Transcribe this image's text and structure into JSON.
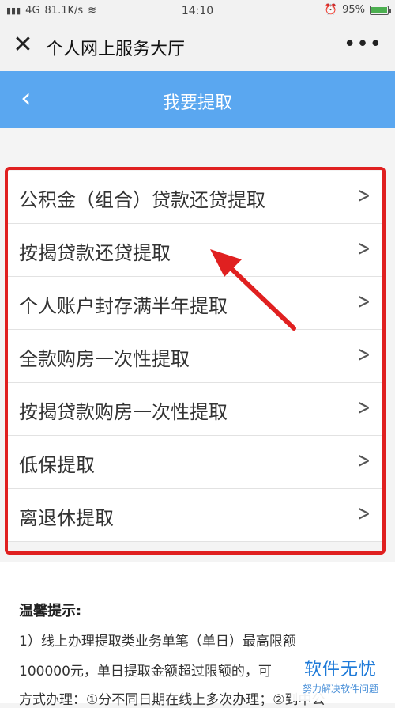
{
  "status_bar": {
    "signal": "4G",
    "speed": "81.1K/s",
    "time": "14:10",
    "alarm_icon": "alarm-icon",
    "battery": "95%"
  },
  "title_bar": {
    "close_icon": "close-icon",
    "title": "个人网上服务大厅",
    "more_icon": "more-icon"
  },
  "header": {
    "back_icon": "back-icon",
    "title": "我要提取"
  },
  "list": {
    "items": [
      {
        "label": "公积金（组合）贷款还贷提取"
      },
      {
        "label": "按揭贷款还贷提取"
      },
      {
        "label": "个人账户封存满半年提取"
      },
      {
        "label": "全款购房一次性提取"
      },
      {
        "label": "按揭贷款购房一次性提取"
      },
      {
        "label": "低保提取"
      },
      {
        "label": "离退休提取"
      }
    ],
    "chevron_icon": "chevron-right-icon"
  },
  "tips": {
    "title": "温馨提示:",
    "line1": "1）线上办理提取类业务单笔（单日）最高限额",
    "line2": "100000元，单日提取金额超过限额的，可",
    "line3": "方式办理：①分不同日期在线上多次办理；②到中公"
  },
  "watermark": {
    "main": "软件无忧",
    "sub": "努力解决软件问题"
  },
  "colors": {
    "header_blue": "#5aa7f0",
    "highlight_red": "#e02020"
  }
}
